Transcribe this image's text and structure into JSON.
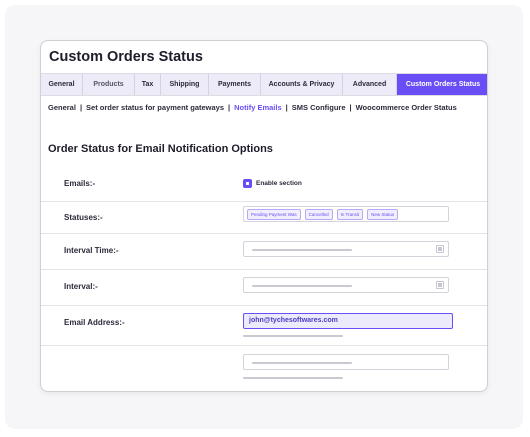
{
  "page": {
    "title": "Custom Orders Status"
  },
  "tabs": [
    {
      "label": "General"
    },
    {
      "label": "Products"
    },
    {
      "label": "Tax"
    },
    {
      "label": "Shipping"
    },
    {
      "label": "Payments"
    },
    {
      "label": "Accounts & Privacy"
    },
    {
      "label": "Advanced"
    },
    {
      "label": "Custom Orders Status",
      "active": true
    }
  ],
  "subnav": [
    {
      "label": "General"
    },
    {
      "label": "Set order status for payment gateways"
    },
    {
      "label": "Notify Emails",
      "active": true
    },
    {
      "label": "SMS Configure"
    },
    {
      "label": "Woocommerce Order Status"
    }
  ],
  "subnav_separator": "|",
  "section": {
    "title": "Order Status for Email Notification Options"
  },
  "form": {
    "emails": {
      "label": "Emails:-",
      "checkbox_label": "Enable section",
      "checked": true
    },
    "statuses": {
      "label": "Statuses:-",
      "tags": [
        "Pending Payment Was",
        "Cancelled",
        "In Transit",
        "New Status"
      ]
    },
    "interval_time": {
      "label": "Interval Time:-"
    },
    "interval": {
      "label": "Interval:-"
    },
    "email_address": {
      "label": "Email Address:-",
      "value": "john@tychesoftwares.com"
    }
  },
  "colors": {
    "accent": "#6a4ef5",
    "tab_background": "#ecebf7",
    "input_focus_background": "#ecebfb"
  }
}
